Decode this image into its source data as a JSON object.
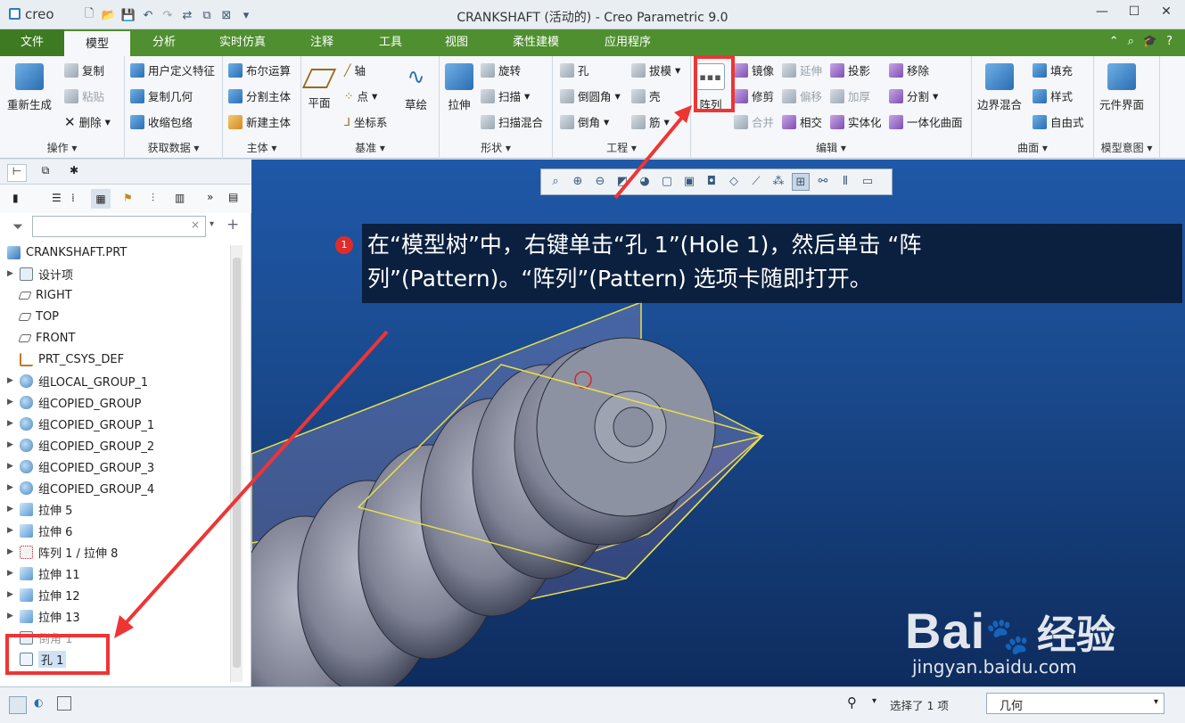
{
  "window": {
    "logo": "creo",
    "title": "CRANKSHAFT (活动的) - Creo Parametric 9.0"
  },
  "tabs": {
    "file": "文件",
    "model": "模型",
    "analysis": "分析",
    "live_sim": "实时仿真",
    "annotate": "注释",
    "tools": "工具",
    "view": "视图",
    "flexible": "柔性建模",
    "apps": "应用程序"
  },
  "ribbon": {
    "operations": {
      "regenerate": "重新生成",
      "copy": "复制",
      "paste": "粘贴",
      "delete": "删除",
      "label": "操作"
    },
    "get_data": {
      "udf": "用户定义特征",
      "copy_geom": "复制几何",
      "shrinkwrap": "收缩包络",
      "label": "获取数据"
    },
    "body": {
      "boolean": "布尔运算",
      "split_body": "分割主体",
      "new_body": "新建主体",
      "label": "主体"
    },
    "datum": {
      "plane": "平面",
      "axis": "轴",
      "point": "点",
      "csys": "坐标系",
      "sketch": "草绘",
      "label": "基准"
    },
    "shapes": {
      "extrude": "拉伸",
      "revolve": "旋转",
      "sweep": "扫描",
      "swept_blend": "扫描混合",
      "label": "形状"
    },
    "engineering": {
      "hole": "孔",
      "round": "倒圆角",
      "chamfer": "倒角",
      "draft": "拔模",
      "shell": "壳",
      "rib": "筋",
      "label": "工程"
    },
    "editing": {
      "pattern": "阵列",
      "mirror": "镜像",
      "trim": "修剪",
      "merge": "合并",
      "extend": "延伸",
      "offset": "偏移",
      "intersect": "相交",
      "project": "投影",
      "thicken": "加厚",
      "solidify": "实体化",
      "remove": "移除",
      "split": "分割",
      "unify": "一体化曲面",
      "label": "编辑"
    },
    "surfaces": {
      "boundary_blend": "边界混合",
      "fill": "填充",
      "style": "样式",
      "freestyle": "自由式",
      "label": "曲面"
    },
    "model_intent": {
      "component_interface": "元件界面",
      "label": "模型意图"
    }
  },
  "tree": {
    "items": [
      {
        "label": "CRANKSHAFT.PRT",
        "icon": "part-icon",
        "expand": false
      },
      {
        "label": "设计项",
        "icon": "settings-icon",
        "expand": true
      },
      {
        "label": "RIGHT",
        "icon": "datum-plane-icon",
        "expand": false
      },
      {
        "label": "TOP",
        "icon": "datum-plane-icon",
        "expand": false
      },
      {
        "label": "FRONT",
        "icon": "datum-plane-icon",
        "expand": false
      },
      {
        "label": "PRT_CSYS_DEF",
        "icon": "csys-icon",
        "expand": false
      },
      {
        "label": "组LOCAL_GROUP_1",
        "icon": "group-icon",
        "expand": true
      },
      {
        "label": "组COPIED_GROUP",
        "icon": "group-icon",
        "expand": true
      },
      {
        "label": "组COPIED_GROUP_1",
        "icon": "group-icon",
        "expand": true
      },
      {
        "label": "组COPIED_GROUP_2",
        "icon": "group-icon",
        "expand": true
      },
      {
        "label": "组COPIED_GROUP_3",
        "icon": "group-icon",
        "expand": true
      },
      {
        "label": "组COPIED_GROUP_4",
        "icon": "group-icon",
        "expand": true
      },
      {
        "label": "拉伸 5",
        "icon": "extrude-icon",
        "expand": true
      },
      {
        "label": "拉伸 6",
        "icon": "extrude-icon",
        "expand": true
      },
      {
        "label": "阵列 1 / 拉伸 8",
        "icon": "pattern-icon",
        "expand": true
      },
      {
        "label": "拉伸 11",
        "icon": "extrude-icon",
        "expand": true
      },
      {
        "label": "拉伸 12",
        "icon": "extrude-icon",
        "expand": true
      },
      {
        "label": "拉伸 13",
        "icon": "extrude-icon",
        "expand": true
      },
      {
        "label": "倒角 1",
        "icon": "chamfer-icon",
        "expand": false
      },
      {
        "label": "孔 1",
        "icon": "hole-icon",
        "expand": false
      }
    ]
  },
  "callout": {
    "number": "1",
    "line1": "在“模型树”中，右键单击“孔 1”(Hole 1)，然后单击 “阵",
    "line2": "列”(Pattern)。“阵列”(Pattern) 选项卡随即打开。"
  },
  "status": {
    "selected": "选择了 1 项",
    "filter_value": "几何"
  },
  "watermark": {
    "brand": "Bai",
    "brand2": "经验",
    "url": "jingyan.baidu.com"
  },
  "colors": {
    "ribbon_tab_green": "#4f8f2f",
    "viewport_blue": "#1f58a7",
    "highlight_red": "#ee3535"
  }
}
